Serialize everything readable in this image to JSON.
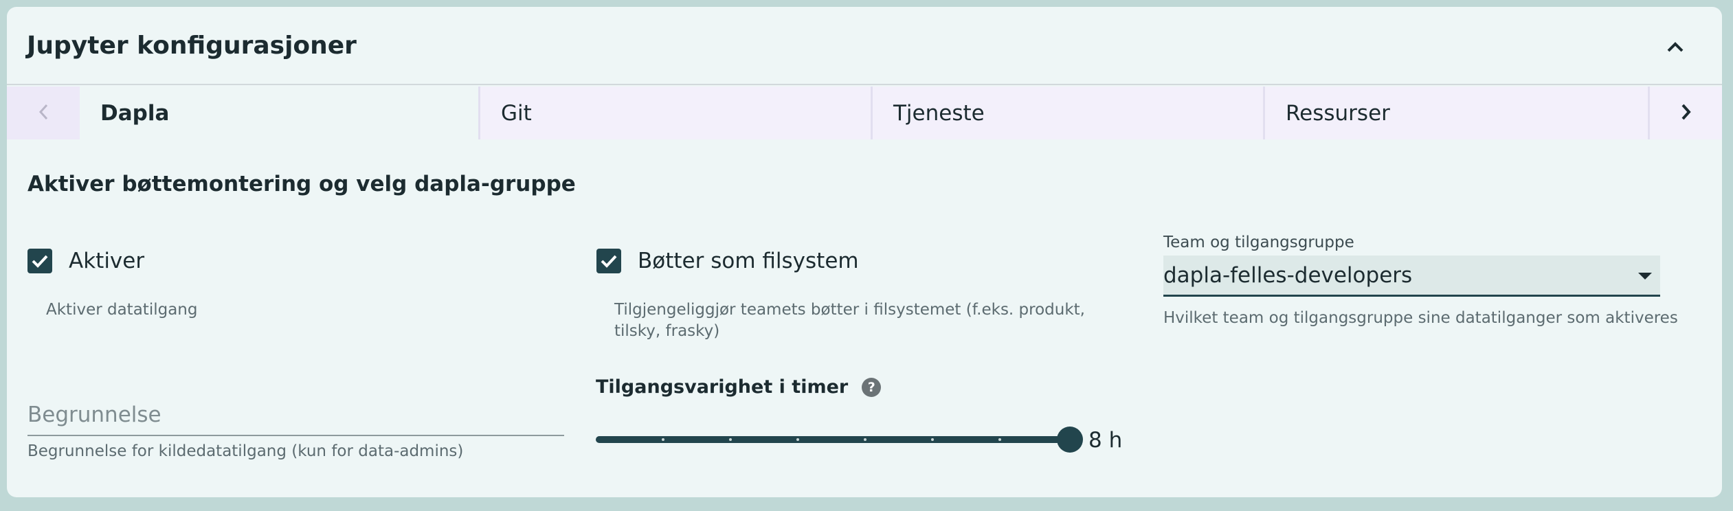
{
  "panel": {
    "title": "Jupyter konfigurasjoner",
    "collapse_icon": "chevron-up-icon"
  },
  "tabs": {
    "items": [
      {
        "label": "Dapla",
        "active": true
      },
      {
        "label": "Git",
        "active": false
      },
      {
        "label": "Tjeneste",
        "active": false
      },
      {
        "label": "Ressurser",
        "active": false
      }
    ],
    "left_icon": "chevron-left-icon",
    "right_icon": "chevron-right-icon"
  },
  "dapla": {
    "section_title": "Aktiver bøttemontering og velg dapla-gruppe",
    "activate": {
      "label": "Aktiver",
      "checked": true,
      "helper": "Aktiver datatilgang"
    },
    "buckets": {
      "label": "Bøtter som filsystem",
      "checked": true,
      "helper": "Tilgjengeliggjør teamets bøtter i filsystemet (f.eks. produkt, tilsky, frasky)"
    },
    "team_select": {
      "label": "Team og tilgangsgruppe",
      "value": "dapla-felles-developers",
      "helper": "Hvilket team og tilgangsgruppe sine datatilganger som aktiveres"
    },
    "reason": {
      "placeholder": "Begrunnelse",
      "value": "",
      "helper": "Begrunnelse for kildedatatilgang (kun for data-admins)"
    },
    "duration": {
      "title": "Tilgangsvarighet i timer",
      "help_icon": "question-icon",
      "value": 8,
      "max": 8,
      "value_label": "8 h"
    }
  },
  "colors": {
    "accent": "#22454d",
    "card_background": "#eef6f6",
    "tab_background": "#f3f0fb",
    "page_background": "#bfd8d6"
  }
}
